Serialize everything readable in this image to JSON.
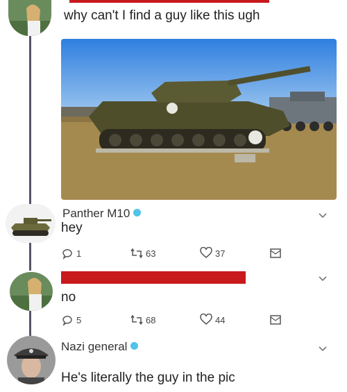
{
  "tweet1": {
    "text": "why can't I find a guy like this ugh",
    "image_alt_icon": "tank-photo"
  },
  "tweet2": {
    "author": "Panther M10",
    "text": "hey",
    "replies": "1",
    "retweets": "63",
    "likes": "37"
  },
  "tweet3": {
    "text": "no",
    "replies": "5",
    "retweets": "68",
    "likes": "44"
  },
  "tweet4": {
    "author": "Nazi general",
    "text": "He's literally the guy in the pic"
  },
  "colors": {
    "redaction": "#c8191c",
    "verified": "#4fc3e8",
    "thread_line": "#555566"
  }
}
